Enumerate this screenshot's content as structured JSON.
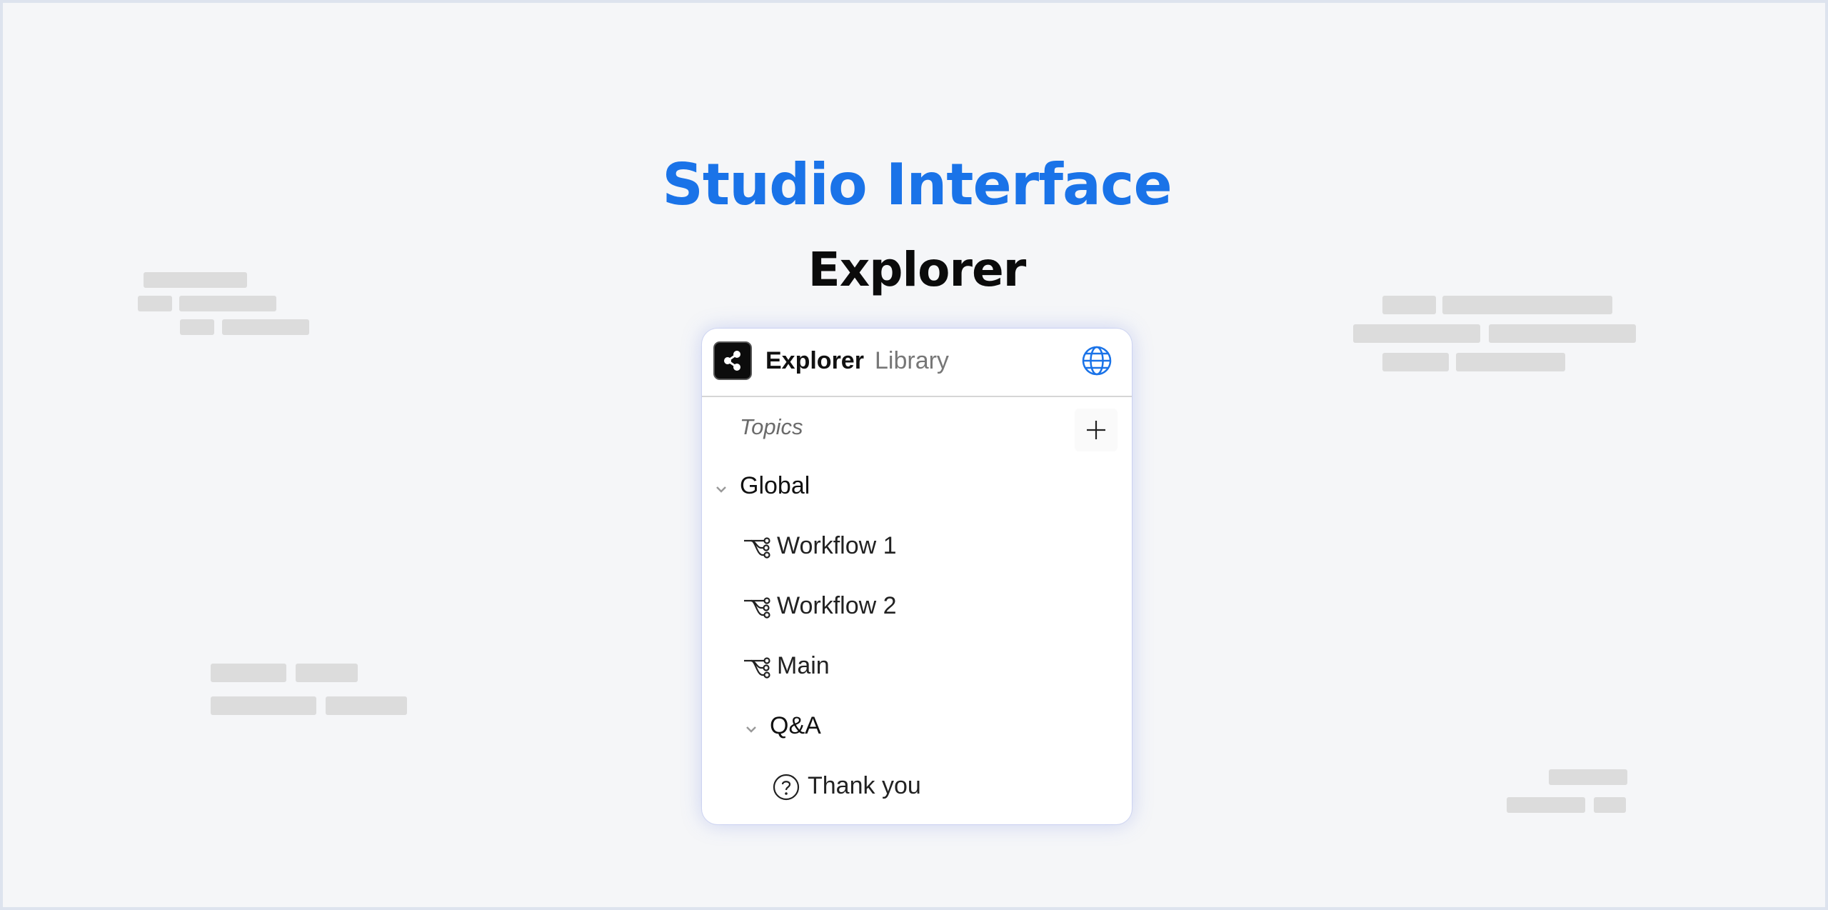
{
  "hero": {
    "title": "Studio Interface",
    "subtitle": "Explorer"
  },
  "panel": {
    "tabs": [
      {
        "label": "Explorer",
        "active": true
      },
      {
        "label": "Library",
        "active": false
      }
    ],
    "section_label": "Topics",
    "tree": {
      "global": {
        "label": "Global",
        "expanded": true,
        "items": [
          {
            "label": "Workflow 1",
            "icon": "workflow-icon"
          },
          {
            "label": "Workflow 2",
            "icon": "workflow-icon"
          },
          {
            "label": "Main",
            "icon": "workflow-icon"
          }
        ],
        "subgroup": {
          "label": "Q&A",
          "expanded": true,
          "items": [
            {
              "label": "Thank you",
              "icon": "question-circle-icon"
            }
          ]
        }
      }
    }
  },
  "colors": {
    "accent": "#1a73e8",
    "background": "#f5f6f8",
    "panel": "#ffffff",
    "placeholder": "#dcdcdc"
  }
}
